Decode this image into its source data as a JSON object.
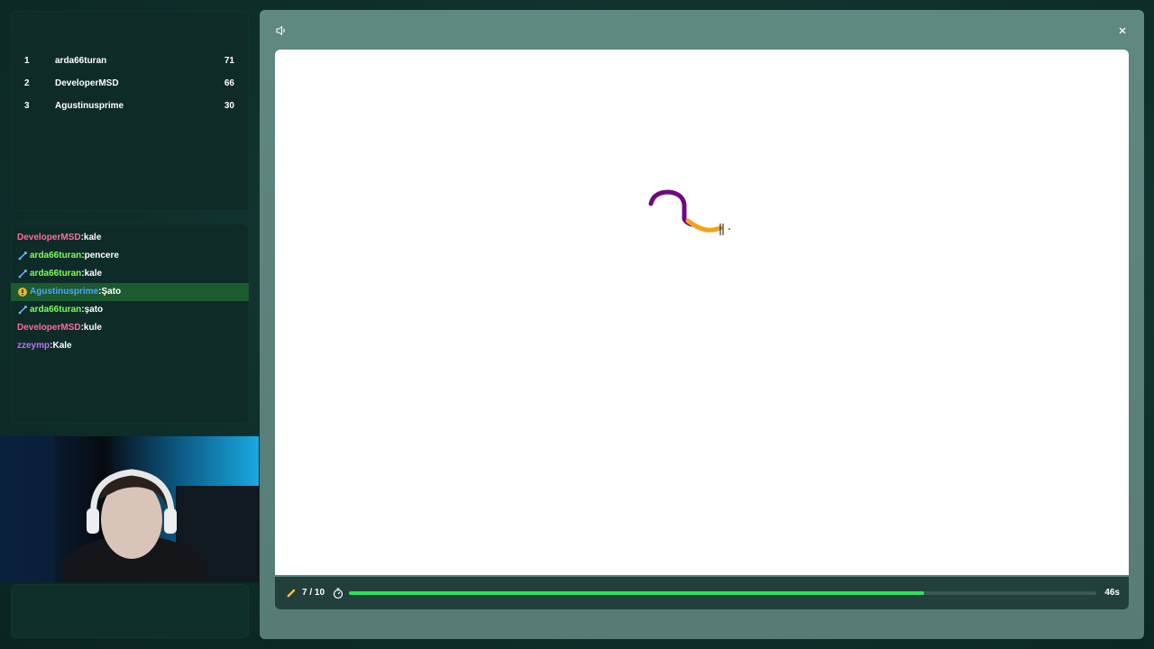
{
  "leaderboard": {
    "rows": [
      {
        "rank": "1",
        "name": "arda66turan",
        "score": "71"
      },
      {
        "rank": "2",
        "name": "DeveloperMSD",
        "score": "66"
      },
      {
        "rank": "3",
        "name": "Agustinusprime",
        "score": "30"
      }
    ]
  },
  "chat": {
    "messages": [
      {
        "user": "DeveloperMSD",
        "sep": ":",
        "text": "kale"
      },
      {
        "user": "arda66turan",
        "sep": ":",
        "text": "pencere"
      },
      {
        "user": "arda66turan",
        "sep": ":",
        "text": "kale"
      },
      {
        "user": "Agustinusprime",
        "sep": ":",
        "text": "Şato"
      },
      {
        "user": "arda66turan",
        "sep": ":",
        "text": "şato"
      },
      {
        "user": "DeveloperMSD",
        "sep": ":",
        "text": "kule"
      },
      {
        "user": "zzeymp",
        "sep": ":",
        "text": "Kale"
      }
    ]
  },
  "game": {
    "round": "7 / 10",
    "time_left": "46s",
    "time_progress": 0.77,
    "colors": {
      "stroke1": "#6e0a7e",
      "stroke2": "#f2a31b",
      "progress": "#2ee25a"
    }
  },
  "icons": {
    "sound": "speaker-icon",
    "close": "close-icon",
    "pencil": "pencil-icon",
    "timer": "stopwatch-icon",
    "sword": "sword-icon",
    "alert": "alert-icon"
  }
}
